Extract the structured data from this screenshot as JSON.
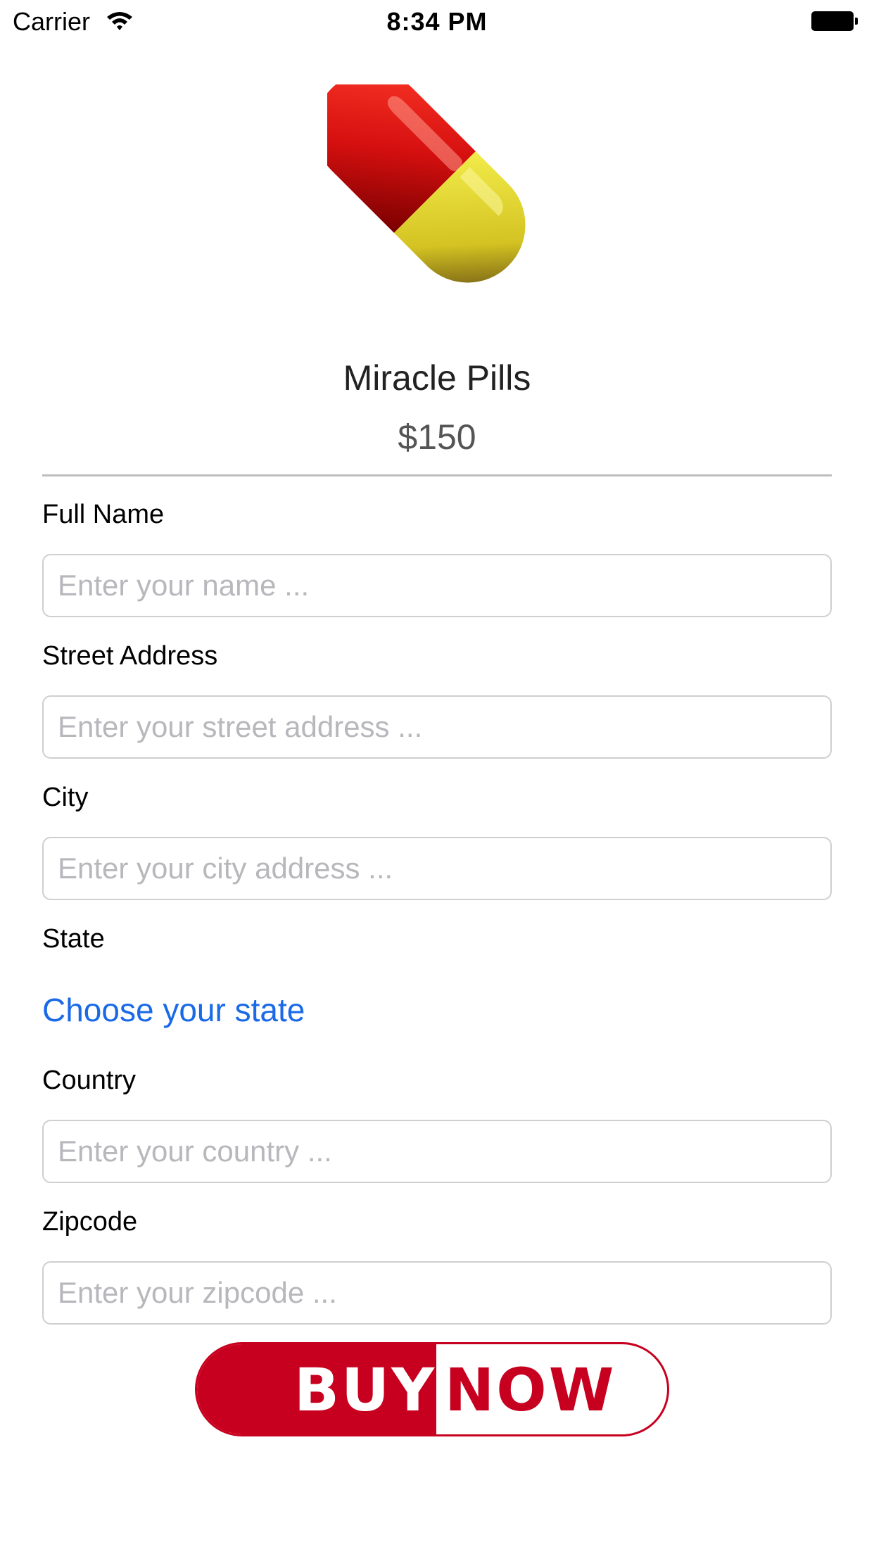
{
  "status_bar": {
    "carrier": "Carrier",
    "time": "8:34 PM",
    "wifi_icon": "wifi-icon",
    "battery_icon": "battery-icon"
  },
  "product": {
    "image_icon": "pill-icon",
    "name": "Miracle Pills",
    "price": "$150"
  },
  "form": {
    "full_name": {
      "label": "Full Name",
      "placeholder": "Enter your name ...",
      "value": ""
    },
    "street": {
      "label": "Street Address",
      "placeholder": "Enter your street address ...",
      "value": ""
    },
    "city": {
      "label": "City",
      "placeholder": "Enter your city address ...",
      "value": ""
    },
    "state": {
      "label": "State",
      "link_text": "Choose your state"
    },
    "country": {
      "label": "Country",
      "placeholder": "Enter your country ...",
      "value": ""
    },
    "zipcode": {
      "label": "Zipcode",
      "placeholder": "Enter your zipcode ...",
      "value": ""
    }
  },
  "buy_button": {
    "left_text": "BUY",
    "right_text": "NOW",
    "color": "#c8001f"
  },
  "colors": {
    "link": "#1a6ae8",
    "placeholder": "#b7b7bc",
    "divider": "#bdbdbd"
  }
}
